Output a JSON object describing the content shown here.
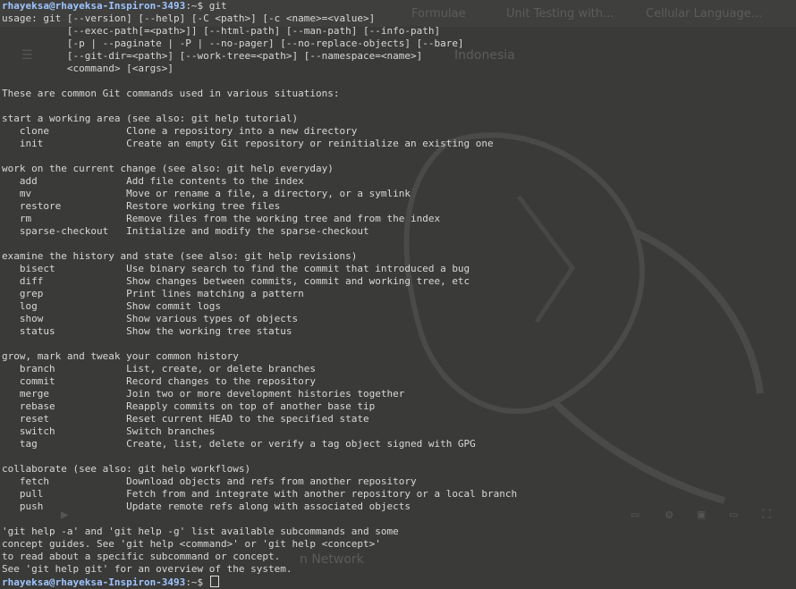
{
  "background": {
    "tabs": [
      "Formulae",
      "Unit Testing with...",
      "Cellular Language..."
    ],
    "page_word": "Indonesia",
    "footer_word": "n Network"
  },
  "terminal": {
    "prompt": "rhayeksa@rhayeksa-Inspiron-3493",
    "prompt_suffix": ":~$",
    "command": " git",
    "lines": [
      "usage: git [--version] [--help] [-C <path>] [-c <name>=<value>]",
      "           [--exec-path[=<path>]] [--html-path] [--man-path] [--info-path]",
      "           [-p | --paginate | -P | --no-pager] [--no-replace-objects] [--bare]",
      "           [--git-dir=<path>] [--work-tree=<path>] [--namespace=<name>]",
      "           <command> [<args>]",
      "",
      "These are common Git commands used in various situations:",
      "",
      "start a working area (see also: git help tutorial)",
      "   clone             Clone a repository into a new directory",
      "   init              Create an empty Git repository or reinitialize an existing one",
      "",
      "work on the current change (see also: git help everyday)",
      "   add               Add file contents to the index",
      "   mv                Move or rename a file, a directory, or a symlink",
      "   restore           Restore working tree files",
      "   rm                Remove files from the working tree and from the index",
      "   sparse-checkout   Initialize and modify the sparse-checkout",
      "",
      "examine the history and state (see also: git help revisions)",
      "   bisect            Use binary search to find the commit that introduced a bug",
      "   diff              Show changes between commits, commit and working tree, etc",
      "   grep              Print lines matching a pattern",
      "   log               Show commit logs",
      "   show              Show various types of objects",
      "   status            Show the working tree status",
      "",
      "grow, mark and tweak your common history",
      "   branch            List, create, or delete branches",
      "   commit            Record changes to the repository",
      "   merge             Join two or more development histories together",
      "   rebase            Reapply commits on top of another base tip",
      "   reset             Reset current HEAD to the specified state",
      "   switch            Switch branches",
      "   tag               Create, list, delete or verify a tag object signed with GPG",
      "",
      "collaborate (see also: git help workflows)",
      "   fetch             Download objects and refs from another repository",
      "   pull              Fetch from and integrate with another repository or a local branch",
      "   push              Update remote refs along with associated objects",
      "",
      "'git help -a' and 'git help -g' list available subcommands and some",
      "concept guides. See 'git help <command>' or 'git help <concept>'",
      "to read about a specific subcommand or concept.",
      "See 'git help git' for an overview of the system."
    ],
    "final_prompt": "rhayeksa@rhayeksa-Inspiron-3493",
    "final_prompt_suffix": ":~$ "
  }
}
